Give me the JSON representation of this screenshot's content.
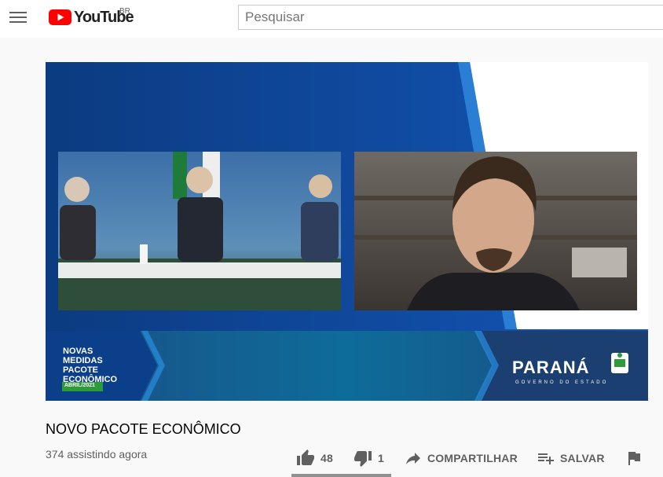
{
  "header": {
    "logo_text": "YouTube",
    "region": "BR",
    "search_placeholder": "Pesquisar"
  },
  "video": {
    "banner_lines": [
      "NOVAS",
      "MEDIDAS",
      "PACOTE",
      "ECONÔMICO"
    ],
    "banner_date": "ABRIL/2021",
    "brand_name": "PARANÁ",
    "brand_sub": "GOVERNO DO ESTADO"
  },
  "title": "NOVO PACOTE ECONÔMICO",
  "viewers": "374 assistindo agora",
  "actions": {
    "likes": "48",
    "dislikes": "1",
    "share_label": "COMPARTILHAR",
    "save_label": "SALVAR"
  },
  "colors": {
    "youtube_red": "#ff0000",
    "player_blue": "#0d3f86",
    "banner_green": "#2f9a3c"
  }
}
